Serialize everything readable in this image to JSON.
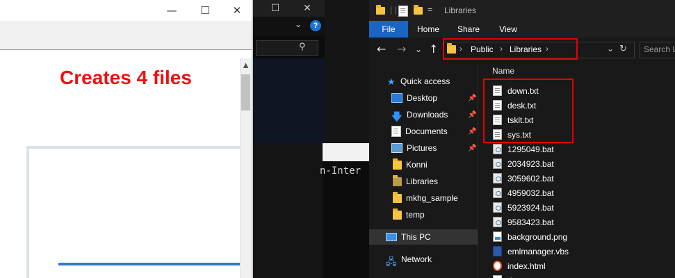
{
  "left_window": {
    "heading": "Creates 4 files",
    "caption_buttons": {
      "minimize": "—",
      "maximize": "☐",
      "close": "✕"
    },
    "scroll_up": "▲"
  },
  "middle_window": {
    "caption_buttons": {
      "maximize": "☐",
      "close": "✕"
    },
    "chevron": "⌄",
    "help": "?",
    "search_glyph": "⚲",
    "terminal_text": "n-Inter"
  },
  "explorer": {
    "title": "Libraries",
    "qat_separators": "| |",
    "qat_dropdown": "=",
    "ribbon_tabs": [
      "File",
      "Home",
      "Share",
      "View"
    ],
    "nav_buttons": {
      "back": "←",
      "forward": "→",
      "recent": "⌄",
      "up": "↑"
    },
    "breadcrumb": [
      "Public",
      "Libraries"
    ],
    "breadcrumb_sep": "›",
    "address_dropdown": "⌄",
    "refresh": "↻",
    "search_placeholder": "Search L",
    "column_header": "Name",
    "pin": "📌",
    "nav": [
      {
        "label": "Quick access",
        "icon": "star-icon"
      },
      {
        "label": "Desktop",
        "icon": "desktop-icon",
        "pinned": true
      },
      {
        "label": "Downloads",
        "icon": "download-icon",
        "pinned": true
      },
      {
        "label": "Documents",
        "icon": "documents-icon",
        "pinned": true
      },
      {
        "label": "Pictures",
        "icon": "pictures-icon",
        "pinned": true
      },
      {
        "label": "Konni",
        "icon": "folder-icon"
      },
      {
        "label": "Libraries",
        "icon": "folder-icon"
      },
      {
        "label": "mkhg_sample",
        "icon": "folder-icon"
      },
      {
        "label": "temp",
        "icon": "folder-icon"
      },
      {
        "label": "This PC",
        "icon": "pc-icon"
      },
      {
        "label": "Network",
        "icon": "network-icon"
      }
    ],
    "files": [
      {
        "name": "down.txt",
        "type": "txt"
      },
      {
        "name": "desk.txt",
        "type": "txt"
      },
      {
        "name": "tsklt.txt",
        "type": "txt"
      },
      {
        "name": "sys.txt",
        "type": "txt"
      },
      {
        "name": "1295049.bat",
        "type": "bat"
      },
      {
        "name": "2034923.bat",
        "type": "bat"
      },
      {
        "name": "3059602.bat",
        "type": "bat"
      },
      {
        "name": "4959032.bat",
        "type": "bat"
      },
      {
        "name": "5923924.bat",
        "type": "bat"
      },
      {
        "name": "9583423.bat",
        "type": "bat"
      },
      {
        "name": "background.png",
        "type": "png"
      },
      {
        "name": "emlmanager.vbs",
        "type": "vbs"
      },
      {
        "name": "index.html",
        "type": "html"
      },
      {
        "name": "d",
        "type": "txt"
      }
    ],
    "colors": {
      "accent": "#1a64c4",
      "highlight": "#e60000"
    }
  }
}
